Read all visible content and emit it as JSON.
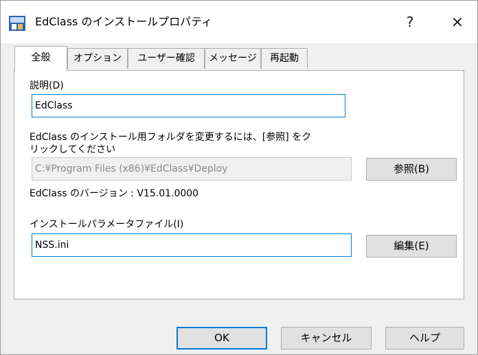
{
  "window": {
    "title": "EdClass のインストールプロパティ",
    "help_glyph": "?",
    "close_glyph": "×"
  },
  "tabs": [
    {
      "label": "全般",
      "active": true
    },
    {
      "label": "オプション",
      "active": false
    },
    {
      "label": "ユーザー確認",
      "active": false
    },
    {
      "label": "メッセージ",
      "active": false
    },
    {
      "label": "再起動",
      "active": false
    }
  ],
  "general": {
    "description_label": "説明(D)",
    "description_value": "EdClass",
    "folder_instruction_line1": "EdClass のインストール用フォルダを変更するには、[参照] をク",
    "folder_instruction_line2": "リックしてください",
    "folder_path": "C:¥Program Files (x86)¥EdClass¥Deploy",
    "browse_button": "参照(B)",
    "version_text": "EdClass のバージョン : V15.01.0000",
    "param_file_label": "インストールパラメータファイル(I)",
    "param_file_value": "NSS.ini",
    "edit_button": "編集(E)"
  },
  "footer": {
    "ok": "OK",
    "cancel": "キャンセル",
    "help": "ヘルプ"
  },
  "colors": {
    "focus_border": "#0078d7",
    "dialog_bg": "#f0f0f0"
  }
}
